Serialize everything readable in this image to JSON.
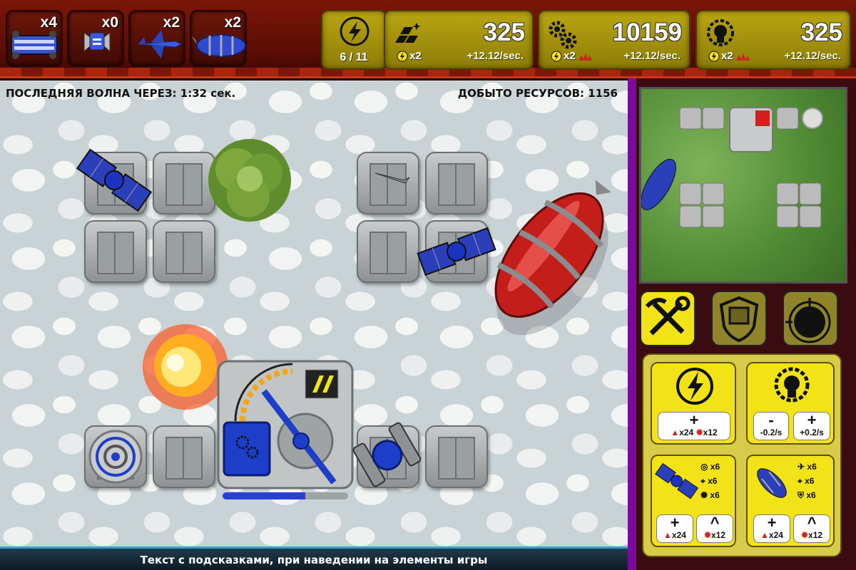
{
  "units": [
    {
      "name": "tank",
      "count": "x4"
    },
    {
      "name": "drone",
      "count": "x0"
    },
    {
      "name": "fighter",
      "count": "x2"
    },
    {
      "name": "airship",
      "count": "x2"
    }
  ],
  "energy": {
    "value": "6 / 11"
  },
  "resources": [
    {
      "name": "gold",
      "value": "325",
      "mult": "x2",
      "rate": "+12.12/sec."
    },
    {
      "name": "gears",
      "value": "10159",
      "mult": "x2",
      "rate": "+12.12/sec."
    },
    {
      "name": "ideas",
      "value": "325",
      "mult": "x2",
      "rate": "+12.12/sec."
    }
  ],
  "field": {
    "wave_label": "ПОСЛЕДНЯЯ ВОЛНА ЧЕРЕЗ: 1:32 сек.",
    "mined_label": "ДОБЫТО РЕСУРСОВ: 1156",
    "build_progress": 0.66
  },
  "hint": "Текст с подсказками, при наведении на элементы игры",
  "actions": {
    "energy": {
      "plus_cost_a": "x24",
      "plus_cost_b": "x12"
    },
    "idea": {
      "minus_label": "-0.2/s",
      "plus_label": "+0.2/s"
    },
    "satellite": {
      "stats": [
        "x6",
        "x6",
        "x6"
      ],
      "plus_cost": "x24",
      "up_cost": "x12"
    },
    "airship": {
      "stats": [
        "x6",
        "x6",
        "x6"
      ],
      "plus_cost": "x24",
      "up_cost": "x12"
    }
  },
  "colors": {
    "accent_yellow": "#f2e218",
    "top_red": "#7a1708",
    "panel_purple": "#7a0a9c"
  }
}
